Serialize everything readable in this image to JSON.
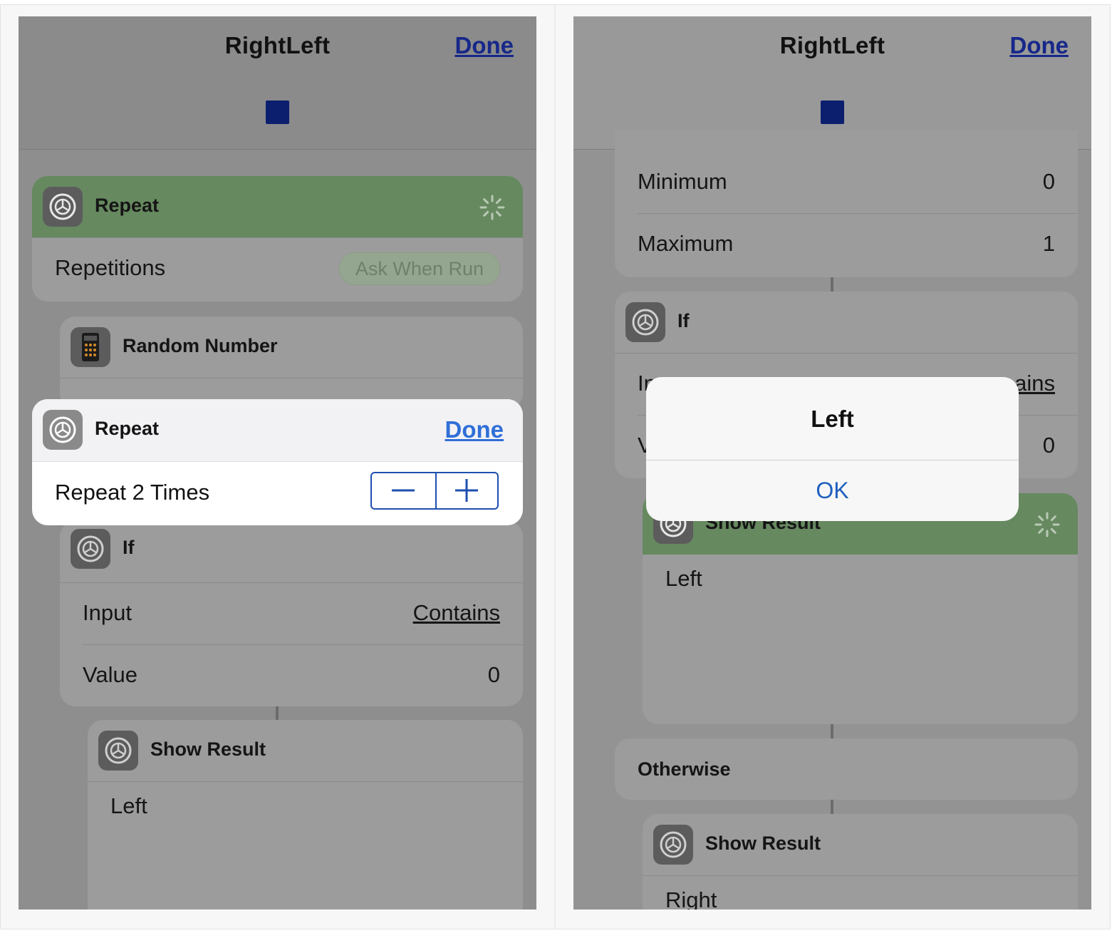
{
  "left_screen": {
    "nav": {
      "title": "RightLeft",
      "done_label": "Done"
    },
    "repeat_card": {
      "title": "Repeat",
      "row_label": "Repetitions",
      "row_value": "Ask When Run"
    },
    "random_card": {
      "title": "Random Number"
    },
    "popover": {
      "title": "Repeat",
      "done_label": "Done",
      "row_label": "Repeat 2 Times"
    },
    "if_card": {
      "title": "If",
      "rows": [
        {
          "label": "Input",
          "value": "Contains"
        },
        {
          "label": "Value",
          "value": "0"
        }
      ]
    },
    "show_result_card": {
      "title": "Show Result",
      "text": "Left"
    }
  },
  "right_screen": {
    "nav": {
      "title": "RightLeft",
      "done_label": "Done"
    },
    "random_rows": [
      {
        "label": "Minimum",
        "value": "0"
      },
      {
        "label": "Maximum",
        "value": "1"
      }
    ],
    "if_card": {
      "title": "If",
      "rows": [
        {
          "label": "In",
          "value": "ains"
        },
        {
          "label": "V",
          "value": "0"
        }
      ]
    },
    "show_result_card": {
      "title": "Show Result",
      "text": "Left"
    },
    "otherwise_card": {
      "title": "Otherwise"
    },
    "show_result_card_2": {
      "title": "Show Result",
      "text": "Right"
    },
    "alert": {
      "title": "Left",
      "ok_label": "OK"
    }
  },
  "colors": {
    "accent_blue": "#2f6fd8",
    "nav_done_blue": "#17288a",
    "running_green": "#66895f",
    "stop_button": "#0b1f6e"
  },
  "icons": [
    "gear-icon",
    "calculator-icon",
    "spinner-icon",
    "stop-icon",
    "minus-icon",
    "plus-icon"
  ]
}
